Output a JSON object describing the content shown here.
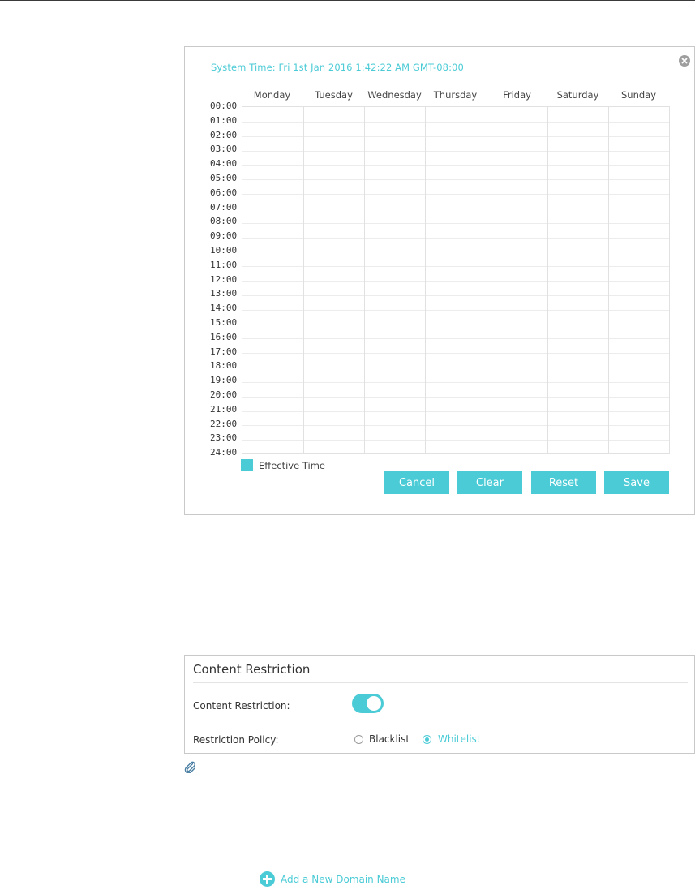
{
  "schedule": {
    "system_time": "System Time: Fri 1st Jan 2016 1:42:22 AM GMT-08:00",
    "days": [
      "Monday",
      "Tuesday",
      "Wednesday",
      "Thursday",
      "Friday",
      "Saturday",
      "Sunday"
    ],
    "hours": [
      "00:00",
      "01:00",
      "02:00",
      "03:00",
      "04:00",
      "05:00",
      "06:00",
      "07:00",
      "08:00",
      "09:00",
      "10:00",
      "11:00",
      "12:00",
      "13:00",
      "14:00",
      "15:00",
      "16:00",
      "17:00",
      "18:00",
      "19:00",
      "20:00",
      "21:00",
      "22:00",
      "23:00",
      "24:00"
    ],
    "legend_label": "Effective Time",
    "buttons": {
      "cancel": "Cancel",
      "clear": "Clear",
      "reset": "Reset",
      "save": "Save"
    },
    "close_icon": "close-icon"
  },
  "content_restriction": {
    "title": "Content Restriction",
    "toggle_label": "Content Restriction:",
    "toggle_on": true,
    "policy_label": "Restriction Policy:",
    "options": {
      "blacklist": "Blacklist",
      "whitelist": "Whitelist"
    },
    "selected": "Whitelist",
    "note_icon": "paperclip-icon"
  },
  "add_domain": {
    "label": "Add a New Domain Name",
    "icon": "plus-circle-icon"
  },
  "colors": {
    "accent": "#4acbd6",
    "border": "#c9c9c9",
    "grid": "#e1e1e1"
  }
}
